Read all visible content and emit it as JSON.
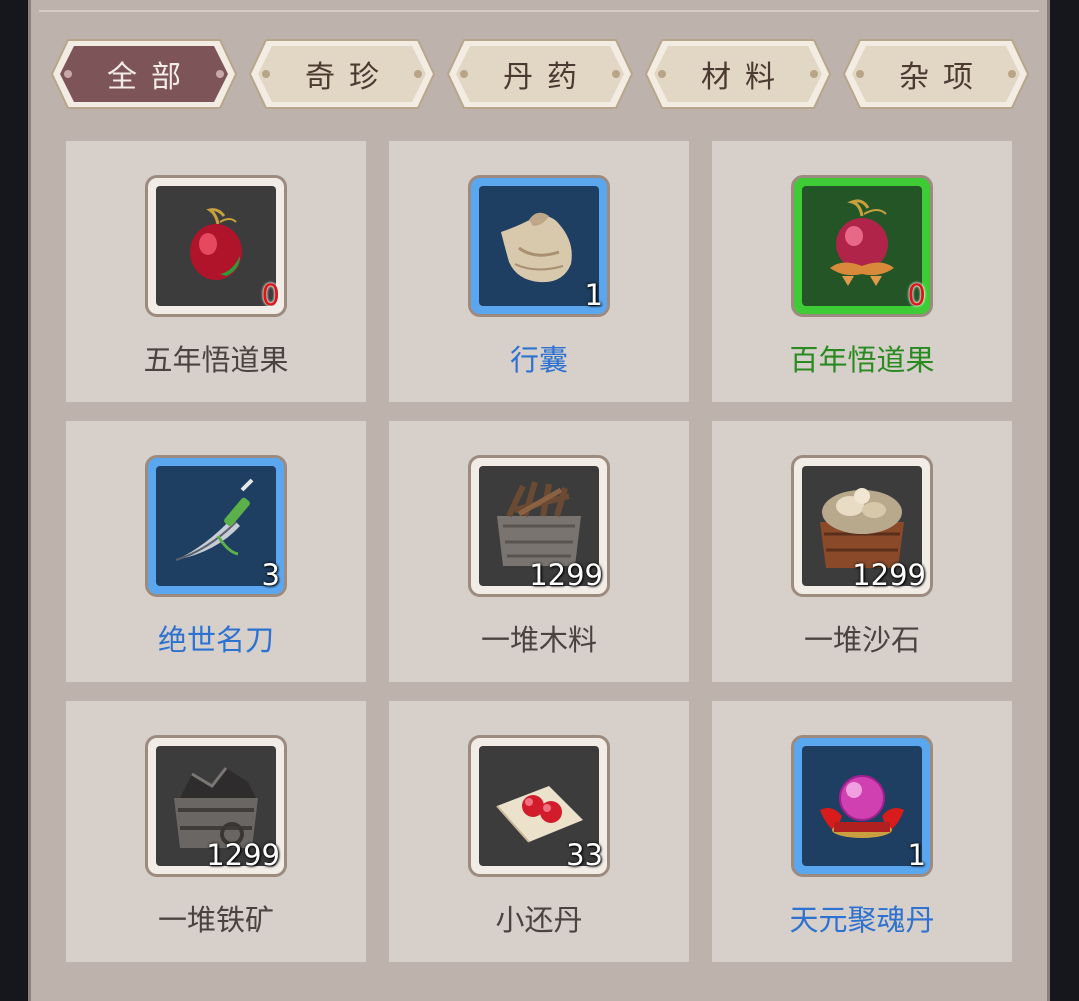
{
  "tabs": [
    {
      "label": "全部",
      "active": true
    },
    {
      "label": "奇珍",
      "active": false
    },
    {
      "label": "丹药",
      "active": false
    },
    {
      "label": "材料",
      "active": false
    },
    {
      "label": "杂项",
      "active": false
    }
  ],
  "items": [
    {
      "name": "五年悟道果",
      "count": "0",
      "rarity": "normal",
      "icon": "red-fruit-icon"
    },
    {
      "name": "行囊",
      "count": "1",
      "rarity": "blue",
      "icon": "cloth-bag-icon"
    },
    {
      "name": "百年悟道果",
      "count": "0",
      "rarity": "green",
      "icon": "lotus-fruit-icon"
    },
    {
      "name": "绝世名刀",
      "count": "3",
      "rarity": "blue",
      "icon": "blade-icon"
    },
    {
      "name": "一堆木料",
      "count": "1299",
      "rarity": "normal",
      "icon": "wood-crate-icon"
    },
    {
      "name": "一堆沙石",
      "count": "1299",
      "rarity": "normal",
      "icon": "sand-crate-icon"
    },
    {
      "name": "一堆铁矿",
      "count": "1299",
      "rarity": "normal",
      "icon": "iron-crate-icon"
    },
    {
      "name": "小还丹",
      "count": "33",
      "rarity": "normal",
      "icon": "red-pills-icon"
    },
    {
      "name": "天元聚魂丹",
      "count": "1",
      "rarity": "blue",
      "icon": "soul-pill-icon"
    }
  ],
  "colors": {
    "tab_active": "#7d5558",
    "tab_inactive": "#e2d6c4",
    "rarity_blue": "#2d72d0",
    "rarity_green": "#2a8a22",
    "zero_count": "#e01414"
  }
}
